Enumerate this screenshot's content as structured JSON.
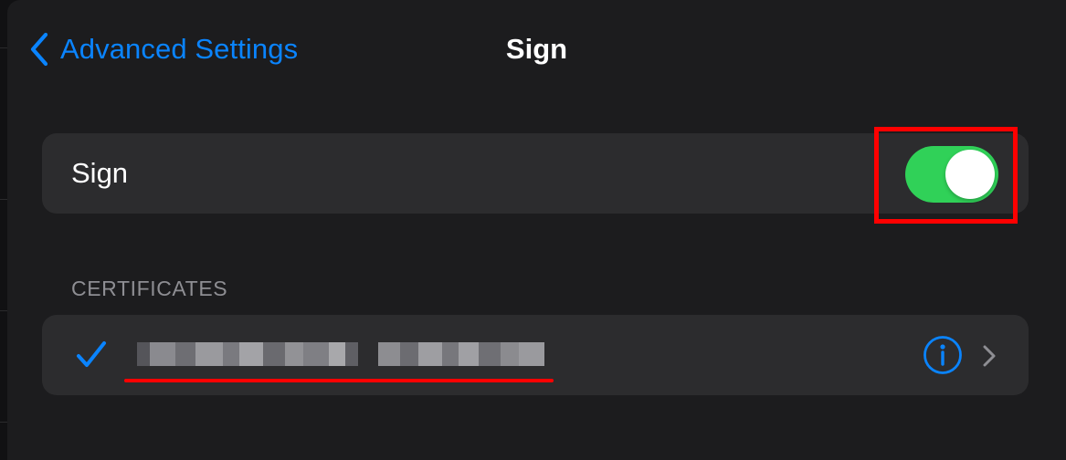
{
  "navigation": {
    "back_label": "Advanced Settings",
    "title": "Sign",
    "back_icon": "chevron-left-icon"
  },
  "sign_row": {
    "label": "Sign",
    "toggle_on": true
  },
  "certificates": {
    "header": "CERTIFICATES",
    "items": [
      {
        "name_redacted": true,
        "selected": true,
        "check_icon": "checkmark-icon",
        "info_icon": "info-icon",
        "disclosure_icon": "chevron-right-icon"
      }
    ]
  },
  "colors": {
    "accent": "#0a84ff",
    "toggle_on": "#30d158",
    "background": "#1c1c1e",
    "cell": "#2c2c2e",
    "secondary_text": "#8e8e93",
    "annotation": "#ff0000"
  }
}
